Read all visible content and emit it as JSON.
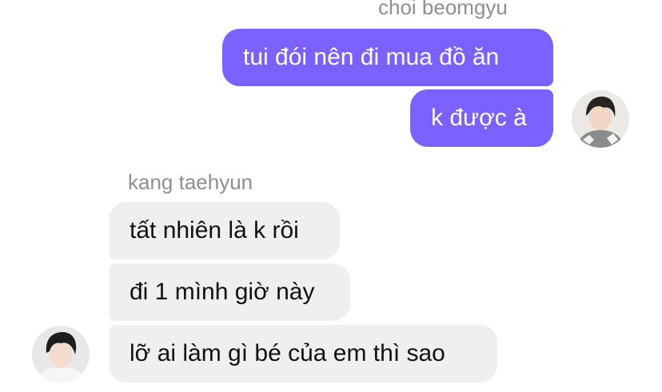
{
  "thread": {
    "outgoing_sender": "choi beomgyu",
    "incoming_sender": "kang taehyun",
    "outgoing_messages": [
      {
        "text": "tui đói nên đi mua đồ ăn"
      },
      {
        "text": "k được à"
      }
    ],
    "incoming_messages": [
      {
        "text": "tất nhiên là k rồi"
      },
      {
        "text": "đi 1 mình giờ này"
      },
      {
        "text": "lỡ ai làm gì bé của em thì sao"
      }
    ]
  },
  "colors": {
    "outgoing_bubble": "#7b61ff",
    "incoming_bubble": "#efeff0",
    "sender_name": "#8e8e93"
  }
}
